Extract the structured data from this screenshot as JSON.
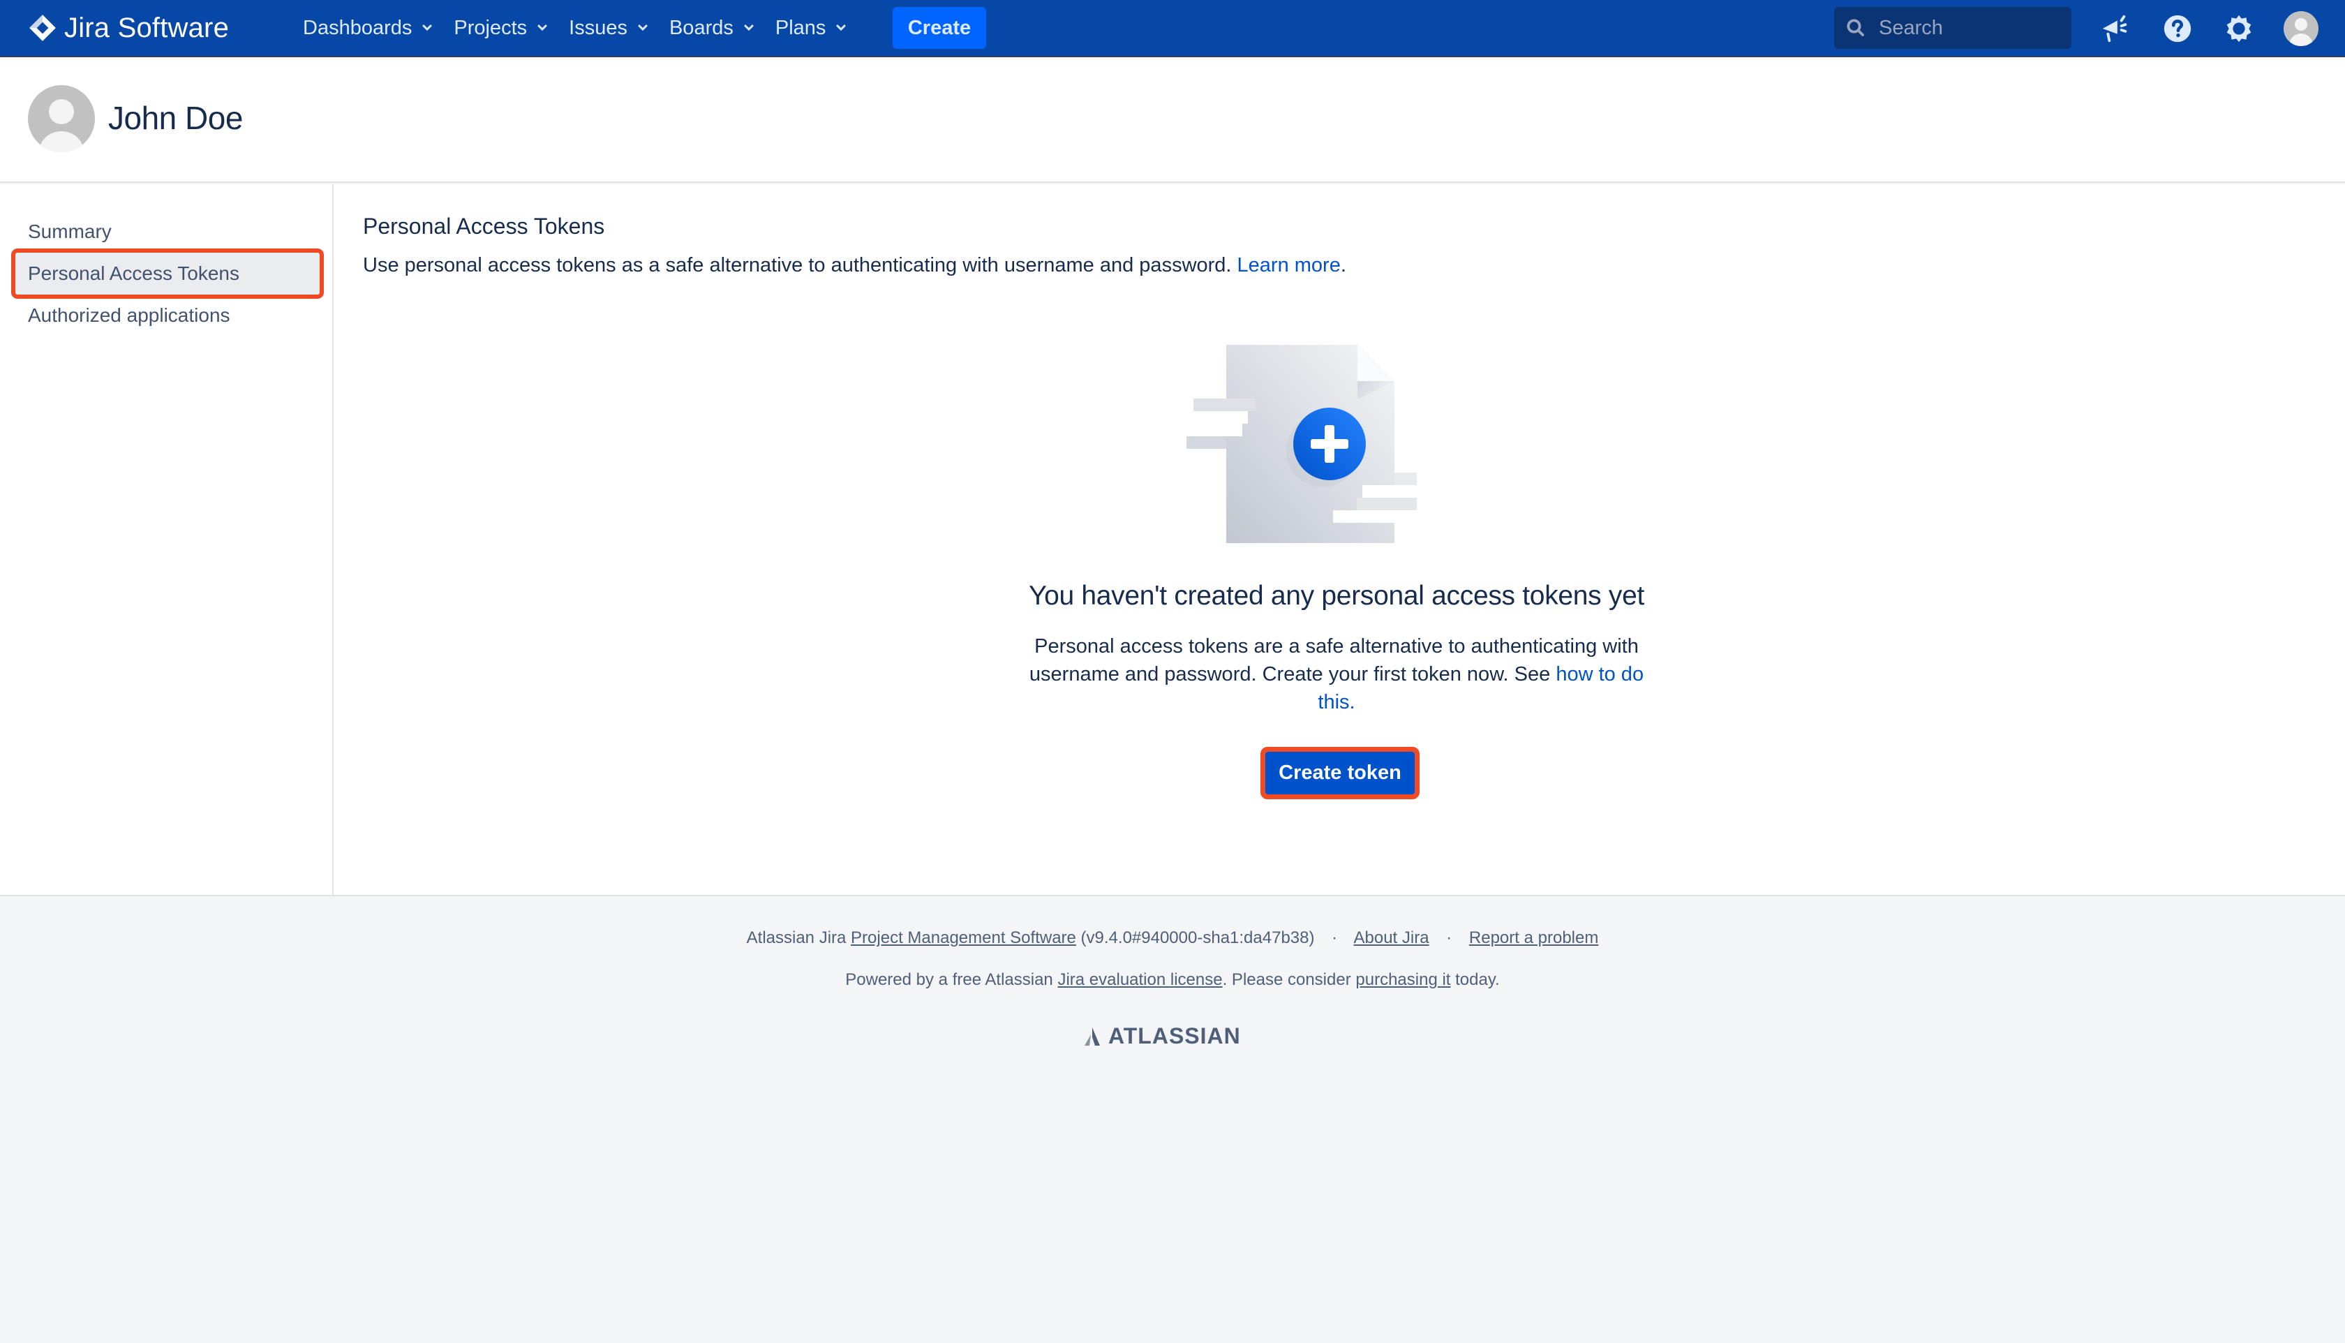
{
  "header": {
    "product_name": "Jira Software",
    "nav": [
      {
        "label": "Dashboards"
      },
      {
        "label": "Projects"
      },
      {
        "label": "Issues"
      },
      {
        "label": "Boards"
      },
      {
        "label": "Plans"
      }
    ],
    "create_label": "Create",
    "search_placeholder": "Search",
    "icons": [
      "megaphone-icon",
      "help-icon",
      "gear-icon",
      "user-avatar"
    ]
  },
  "profile": {
    "name": "John Doe"
  },
  "sidebar": {
    "items": [
      {
        "label": "Summary",
        "active": false
      },
      {
        "label": "Personal Access Tokens",
        "active": true
      },
      {
        "label": "Authorized applications",
        "active": false
      }
    ]
  },
  "main": {
    "title": "Personal Access Tokens",
    "description": "Use personal access tokens as a safe alternative to authenticating with username and password.",
    "learn_more": "Learn more",
    "period": ".",
    "empty_state": {
      "title": "You haven't created any personal access tokens yet",
      "body": "Personal access tokens are a safe alternative to authenticating with username and password. Create your first token now. See",
      "link": "how to do this",
      "link_suffix": ".",
      "button_label": "Create token"
    }
  },
  "footer": {
    "line1_prefix": "Atlassian Jira",
    "line1_link": "Project Management Software",
    "version": "(v9.4.0#940000-sha1:da47b38)",
    "separator": "·",
    "about_link": "About Jira",
    "report_link": "Report a problem",
    "line2_prefix": "Powered by a free Atlassian",
    "license_link": "Jira evaluation license",
    "line2_mid": ". Please consider",
    "purchase_link": "purchasing it",
    "line2_suffix": "today.",
    "brand": "ATLASSIAN"
  },
  "colors": {
    "header_bg": "#0747a6",
    "primary": "#0052cc",
    "create_btn": "#0065ff",
    "highlight_outline": "#f04a24",
    "text": "#172b4d",
    "footer_bg": "#f4f5f7"
  }
}
